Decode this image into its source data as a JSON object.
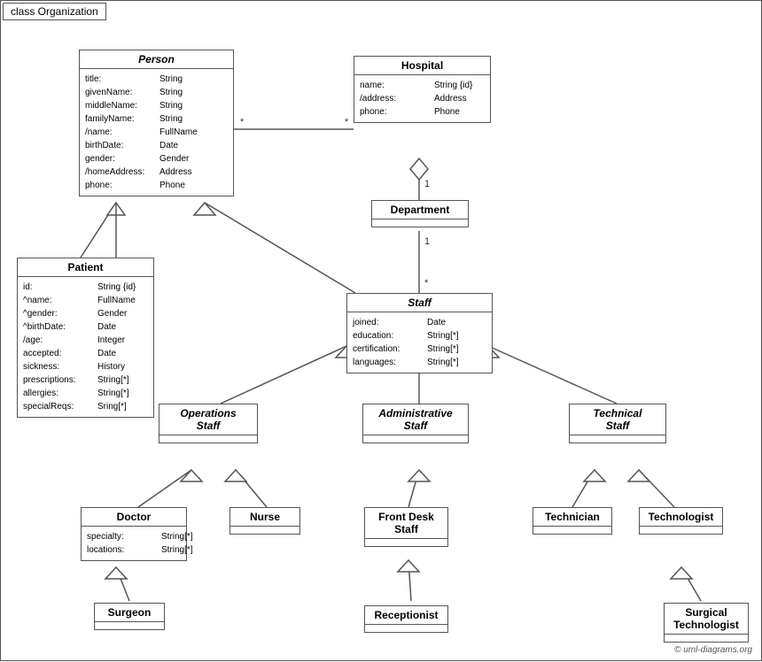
{
  "title": "class Organization",
  "classes": {
    "person": {
      "name": "Person",
      "italic": true,
      "attrs": [
        {
          "name": "title:",
          "type": "String"
        },
        {
          "name": "givenName:",
          "type": "String"
        },
        {
          "name": "middleName:",
          "type": "String"
        },
        {
          "name": "familyName:",
          "type": "String"
        },
        {
          "name": "/name:",
          "type": "FullName"
        },
        {
          "name": "birthDate:",
          "type": "Date"
        },
        {
          "name": "gender:",
          "type": "Gender"
        },
        {
          "name": "/homeAddress:",
          "type": "Address"
        },
        {
          "name": "phone:",
          "type": "Phone"
        }
      ]
    },
    "hospital": {
      "name": "Hospital",
      "italic": false,
      "attrs": [
        {
          "name": "name:",
          "type": "String {id}"
        },
        {
          "name": "/address:",
          "type": "Address"
        },
        {
          "name": "phone:",
          "type": "Phone"
        }
      ]
    },
    "patient": {
      "name": "Patient",
      "italic": false,
      "attrs": [
        {
          "name": "id:",
          "type": "String {id}"
        },
        {
          "name": "^name:",
          "type": "FullName"
        },
        {
          "name": "^gender:",
          "type": "Gender"
        },
        {
          "name": "^birthDate:",
          "type": "Date"
        },
        {
          "name": "/age:",
          "type": "Integer"
        },
        {
          "name": "accepted:",
          "type": "Date"
        },
        {
          "name": "sickness:",
          "type": "History"
        },
        {
          "name": "prescriptions:",
          "type": "String[*]"
        },
        {
          "name": "allergies:",
          "type": "String[*]"
        },
        {
          "name": "specialReqs:",
          "type": "Sring[*]"
        }
      ]
    },
    "department": {
      "name": "Department",
      "italic": false,
      "attrs": []
    },
    "staff": {
      "name": "Staff",
      "italic": true,
      "attrs": [
        {
          "name": "joined:",
          "type": "Date"
        },
        {
          "name": "education:",
          "type": "String[*]"
        },
        {
          "name": "certification:",
          "type": "String[*]"
        },
        {
          "name": "languages:",
          "type": "String[*]"
        }
      ]
    },
    "operationsStaff": {
      "name": "Operations\nStaff",
      "italic": true,
      "attrs": []
    },
    "administrativeStaff": {
      "name": "Administrative\nStaff",
      "italic": true,
      "attrs": []
    },
    "technicalStaff": {
      "name": "Technical\nStaff",
      "italic": true,
      "attrs": []
    },
    "doctor": {
      "name": "Doctor",
      "italic": false,
      "attrs": [
        {
          "name": "specialty:",
          "type": "String[*]"
        },
        {
          "name": "locations:",
          "type": "String[*]"
        }
      ]
    },
    "nurse": {
      "name": "Nurse",
      "italic": false,
      "attrs": []
    },
    "frontDeskStaff": {
      "name": "Front Desk\nStaff",
      "italic": false,
      "attrs": []
    },
    "technician": {
      "name": "Technician",
      "italic": false,
      "attrs": []
    },
    "technologist": {
      "name": "Technologist",
      "italic": false,
      "attrs": []
    },
    "surgeon": {
      "name": "Surgeon",
      "italic": false,
      "attrs": []
    },
    "receptionist": {
      "name": "Receptionist",
      "italic": false,
      "attrs": []
    },
    "surgicalTechnologist": {
      "name": "Surgical\nTechnologist",
      "italic": false,
      "attrs": []
    }
  },
  "copyright": "© uml-diagrams.org"
}
